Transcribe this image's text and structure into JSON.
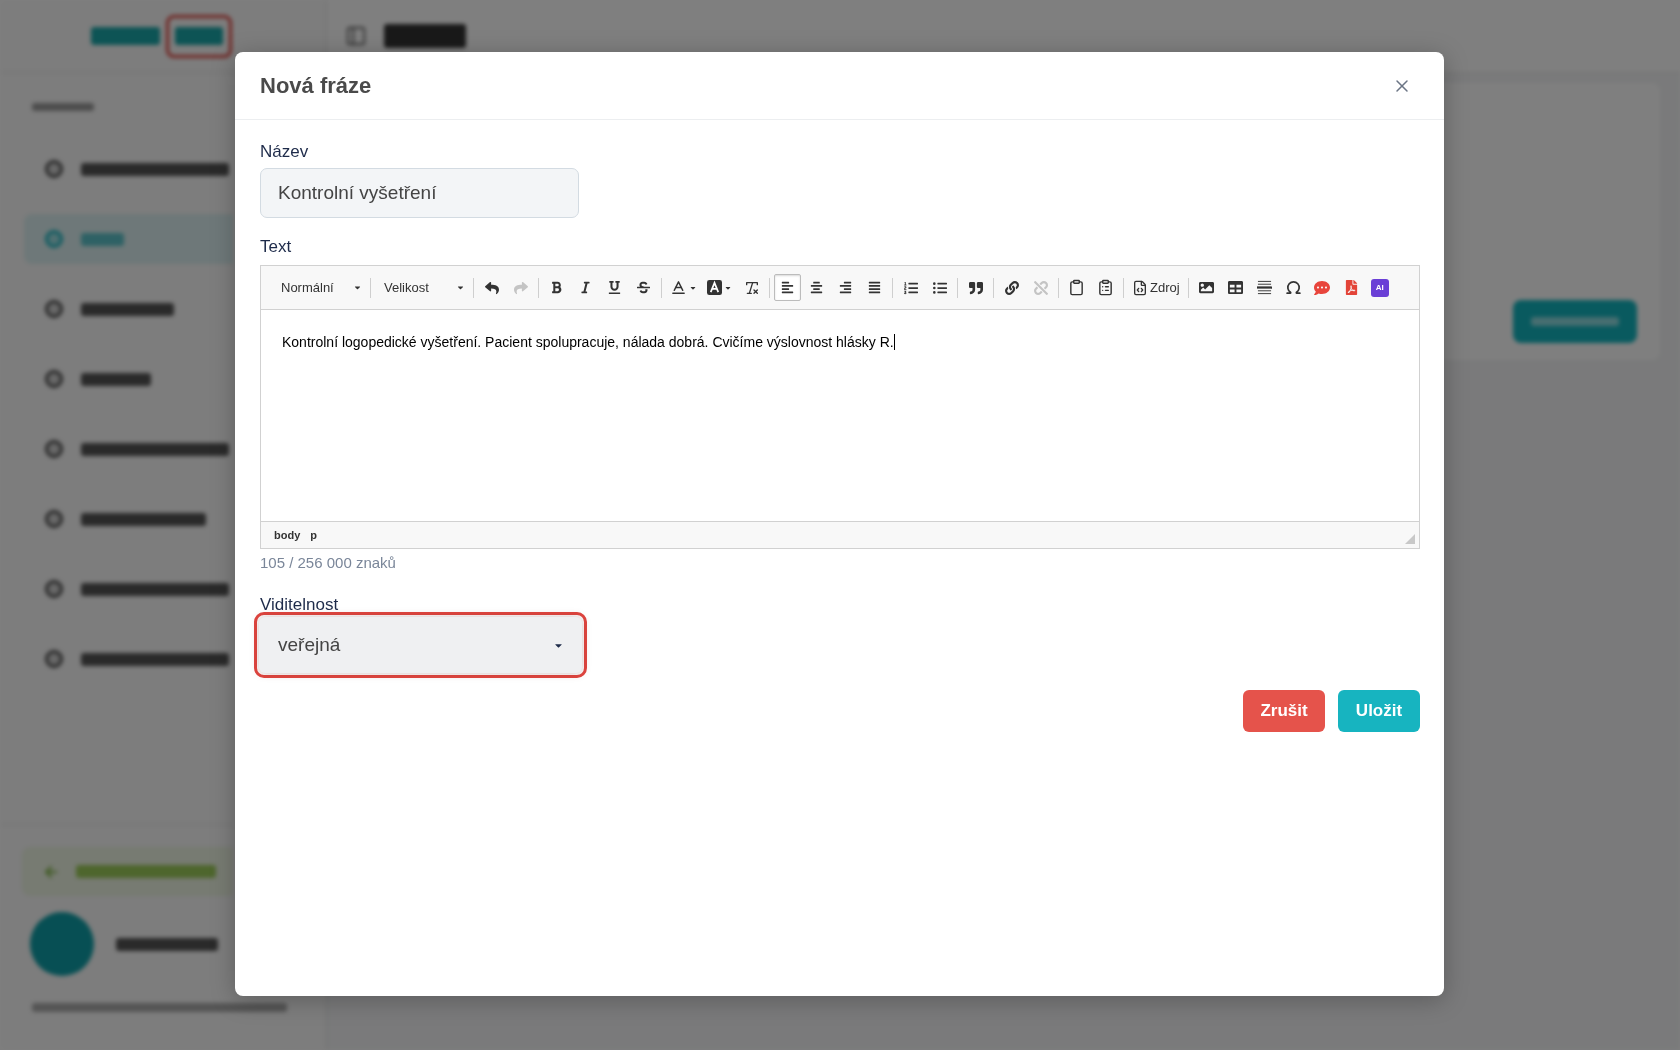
{
  "background": {
    "logo": {
      "badge_highlighted": true
    },
    "sidebar": {
      "items": [
        {
          "selected": false
        },
        {
          "selected": true
        },
        {
          "selected": false
        },
        {
          "selected": false
        },
        {
          "selected": false
        },
        {
          "selected": false
        },
        {
          "selected": false
        },
        {
          "selected": false
        }
      ]
    }
  },
  "dialog": {
    "title": "Nová fráze",
    "name_field": {
      "label": "Název",
      "value": "Kontrolní vyšetření"
    },
    "text_field": {
      "label": "Text",
      "toolbar": {
        "format": "Normální",
        "size": "Velikost",
        "history": [
          {
            "disabled": false
          },
          {
            "disabled": true
          }
        ],
        "alignment": [
          {
            "selected": true
          },
          {
            "selected": false
          },
          {
            "selected": false
          },
          {
            "selected": false
          }
        ],
        "links": [
          {
            "disabled": false
          },
          {
            "disabled": true
          }
        ],
        "source": "Zdroj",
        "ai": "AI"
      },
      "content": "Kontrolní logopedické vyšetření. Pacient spolupracuje, nálada dobrá. Cvičíme výslovnost hlásky R.",
      "path": [
        "body",
        "p"
      ],
      "counter": "105 / 256 000 znaků"
    },
    "visibility": {
      "label": "Viditelnost",
      "value": "veřejná",
      "highlighted": true
    },
    "buttons": [
      {
        "label": "Zrušit",
        "kind": "danger"
      },
      {
        "label": "Uložit",
        "kind": "primary"
      }
    ]
  }
}
